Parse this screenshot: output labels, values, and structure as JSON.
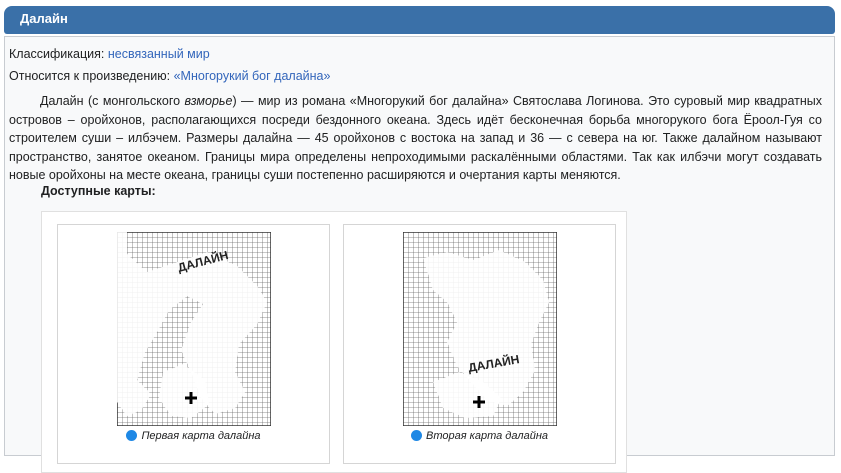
{
  "header": {
    "title": "Далайн"
  },
  "meta": {
    "classification_label": "Классификация:",
    "classification_value": "несвязанный мир",
    "work_label": "Относится к произведению:",
    "work_value": "«Многорукий бог далайна»"
  },
  "description": {
    "p1": "Далайн (с монгольского ",
    "p1_em": "взморье",
    "p2": ") — мир из романа «Многорукий бог далайна» Святослава Логинова. Это суровый мир квадратных островов – оройхонов, располагающихся посреди бездонного океана. Здесь идёт бесконечная борьба многорукого бога Ёроол-Гуя со строителем суши – илбэчем. Размеры далайна — 45 оройхонов с востока на запад и 36 — с севера на юг. Также далайном называют пространство, занятое океаном. Границы мира определены непроходимыми раскалёнными областями. Так как илбэчи могут создавать новые оройхоны на месте океана, границы суши постепенно расширяются и очертания карты меняются."
  },
  "maps": {
    "title": "Доступные карты:",
    "items": [
      {
        "caption": "Первая карта далайна",
        "map_label": "ДАЛАЙН",
        "icon": "info-dot-icon"
      },
      {
        "caption": "Вторая карта далайна",
        "map_label": "ДАЛАЙН",
        "icon": "info-dot-icon"
      }
    ]
  },
  "colors": {
    "header_bg": "#3a70a8",
    "link": "#3366bb",
    "dot": "#1e88e5"
  }
}
